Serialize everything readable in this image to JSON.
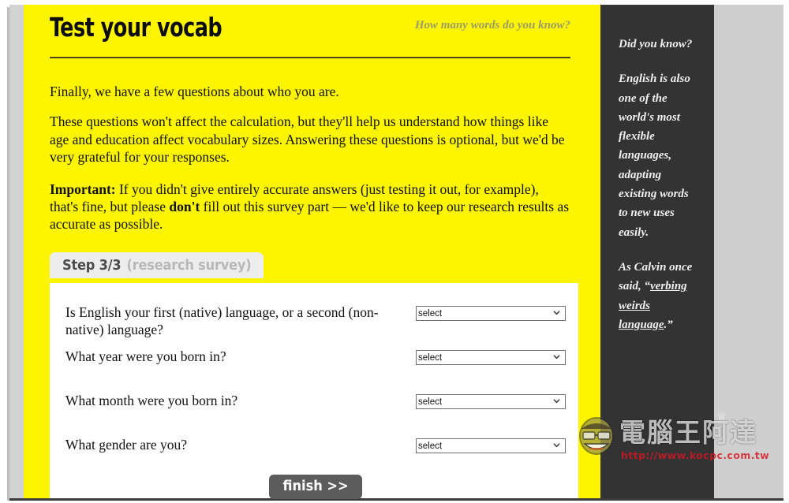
{
  "site": {
    "title": "Test your vocab",
    "tagline": "How many words do you know?"
  },
  "intro": {
    "p1": "Finally, we have a few questions about who you are.",
    "p2": "These questions won't affect the calculation, but they'll help us understand how things like age and education affect vocabulary sizes. Answering these questions is optional, but we'd be very grateful for your responses.",
    "p3_label": "Important:",
    "p3_a": " If you didn't give entirely accurate answers (just testing it out, for example), that's fine, but please ",
    "p3_bold": "don't",
    "p3_b": " fill out this survey part — we'd like to keep our research results as accurate as possible."
  },
  "step": {
    "main": "Step 3/3",
    "sub": "(research survey)"
  },
  "form": {
    "questions": [
      {
        "label": "Is English your first (native) language, or a second (non-native) language?",
        "value": "select",
        "name": "native-language-select"
      },
      {
        "label": "What year were you born in?",
        "value": "select",
        "name": "birth-year-select"
      },
      {
        "label": "What month were you born in?",
        "value": "select",
        "name": "birth-month-select"
      },
      {
        "label": "What gender are you?",
        "value": "select",
        "name": "gender-select"
      }
    ],
    "submit_label": "finish >>"
  },
  "sidebar": {
    "heading": "Did you know?",
    "para1": "English is also one of the world's most flexible languages, adapting existing words to new uses easily.",
    "para2_pre": "As Calvin once said, “",
    "para2_link": "verbing weirds language",
    "para2_post": ".”"
  },
  "watermark": {
    "brand": "電腦王阿達",
    "url": "http://www.kocpc.com.tw",
    "crown": "♕"
  },
  "colors": {
    "page_yellow": "#fdf500",
    "sidebar_dark": "#333333",
    "button_gray": "#5c5c5c",
    "tab_gray": "#ededed",
    "tagline_gray": "#9b9b6a",
    "url_red": "#d61622"
  }
}
